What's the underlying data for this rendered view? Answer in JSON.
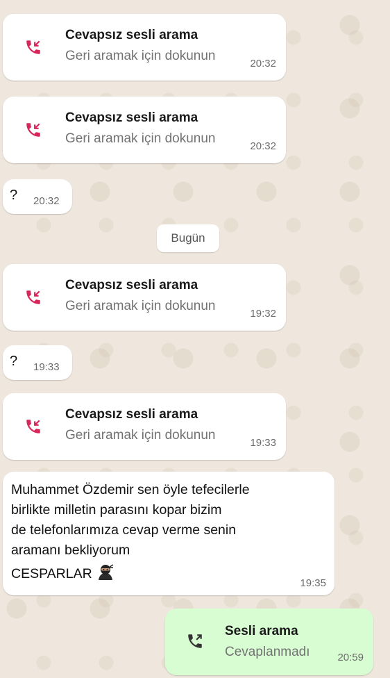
{
  "messages": [
    {
      "type": "missed_call",
      "title": "Cevapsız sesli arama",
      "subtitle": "Geri aramak için dokunun",
      "time": "20:32"
    },
    {
      "type": "missed_call",
      "title": "Cevapsız sesli arama",
      "subtitle": "Geri aramak için dokunun",
      "time": "20:32"
    },
    {
      "type": "text",
      "text": "?",
      "time": "20:32"
    },
    {
      "type": "date",
      "label": "Bugün"
    },
    {
      "type": "missed_call",
      "title": "Cevapsız sesli arama",
      "subtitle": "Geri aramak için dokunun",
      "time": "19:32"
    },
    {
      "type": "text",
      "text": "?",
      "time": "19:33"
    },
    {
      "type": "missed_call",
      "title": "Cevapsız sesli arama",
      "subtitle": "Geri aramak için dokunun",
      "time": "19:33"
    },
    {
      "type": "text",
      "text": "Muhammet Özdemir sen öyle tefecilerle\nbirlikte milletin parasını kopar bizim\nde telefonlarımıza cevap verme senin\naramanı bekliyorum",
      "signature": "CESPARLAR",
      "time": "19:35"
    },
    {
      "type": "outgoing_call",
      "title": "Sesli arama",
      "subtitle": "Cevaplanmadı",
      "time": "20:59"
    }
  ],
  "colors": {
    "missed_call_icon": "#d6265a",
    "outgoing_bubble": "#d9fdd3",
    "background": "#efe7dd"
  },
  "icons": {
    "missed_call": "missed-call-icon",
    "outgoing_call": "outgoing-call-icon",
    "emoji": "ninja-emoji-icon"
  }
}
